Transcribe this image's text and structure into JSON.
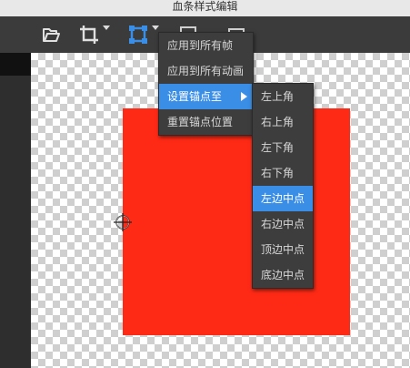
{
  "window": {
    "title": "血条样式编辑"
  },
  "toolbar": {
    "items": [
      {
        "icon": "open-folder-icon"
      },
      {
        "icon": "crop-icon"
      },
      {
        "icon": "anchor-transform-icon"
      },
      {
        "icon": "film-icon"
      },
      {
        "icon": "clapper-icon"
      }
    ]
  },
  "menu": {
    "items": [
      {
        "label": "应用到所有帧"
      },
      {
        "label": "应用到所有动画"
      },
      {
        "label": "设置锚点至",
        "has_submenu": true,
        "highlighted": true
      },
      {
        "label": "重置锚点位置"
      }
    ]
  },
  "submenu": {
    "items": [
      {
        "label": "左上角"
      },
      {
        "label": "右上角"
      },
      {
        "label": "左下角"
      },
      {
        "label": "右下角"
      },
      {
        "label": "左边中点",
        "highlighted": true
      },
      {
        "label": "右边中点"
      },
      {
        "label": "顶边中点"
      },
      {
        "label": "底边中点"
      }
    ]
  },
  "colors": {
    "highlight": "#3a8ee6",
    "sprite": "#ff2a15",
    "transform_icon": "#3a8ee6"
  }
}
